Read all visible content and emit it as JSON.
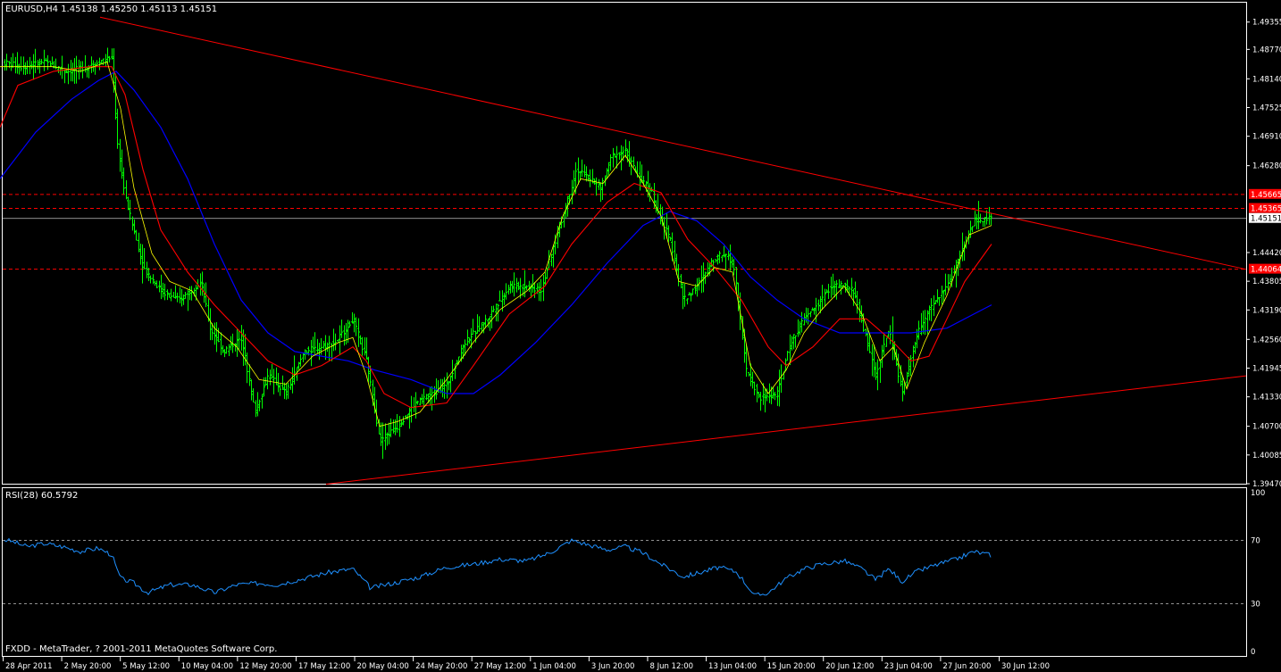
{
  "chart_header": "EURUSD,H4  1.45138 1.45250 1.45113 1.45151",
  "rsi_header": "RSI(28) 60.5792",
  "copyright": "FXDD - MetaTrader, ? 2001-2011 MetaQuotes Software Corp.",
  "colors": {
    "background": "#000000",
    "frame": "#ffffff",
    "bar": "#00ff00",
    "ma_fast": "#ffff00",
    "ma_mid": "#ff0000",
    "ma_slow": "#0000ff",
    "trendline": "#ff0000",
    "level": "#ff0000",
    "bid_line": "#c0c0c0",
    "rsi": "#1e90ff",
    "rsi_level": "#c0c0c0"
  },
  "chart_data": [
    {
      "type": "candlestick",
      "symbol": "EURUSD",
      "timeframe": "H4",
      "ohlc_current": {
        "open": 1.45138,
        "high": 1.4525,
        "low": 1.45113,
        "close": 1.45151
      },
      "ylim": [
        1.3947,
        1.4977
      ],
      "y_ticks": [
        "1.49355",
        "1.48770",
        "1.48140",
        "1.47525",
        "1.46910",
        "1.46280",
        "1.44420",
        "1.43805",
        "1.43190",
        "1.42560",
        "1.41945",
        "1.41330",
        "1.40700",
        "1.40085",
        "1.39470"
      ],
      "x_ticks": [
        "28 Apr 2011",
        "2 May 20:00",
        "5 May 12:00",
        "10 May 04:00",
        "12 May 20:00",
        "17 May 12:00",
        "20 May 04:00",
        "24 May 20:00",
        "27 May 12:00",
        "1 Jun 04:00",
        "3 Jun 20:00",
        "8 Jun 12:00",
        "13 Jun 04:00",
        "15 Jun 20:00",
        "20 Jun 12:00",
        "23 Jun 04:00",
        "27 Jun 20:00",
        "30 Jun 12:00"
      ],
      "bid_price": "1.45151",
      "price_levels": [
        "1.45665",
        "1.45365",
        "1.44064"
      ],
      "close_path": [
        [
          0,
          1.485
        ],
        [
          25,
          1.484
        ],
        [
          50,
          1.485
        ],
        [
          75,
          1.483
        ],
        [
          100,
          1.484
        ],
        [
          125,
          1.486
        ],
        [
          131,
          1.468
        ],
        [
          140,
          1.456
        ],
        [
          160,
          1.441
        ],
        [
          180,
          1.436
        ],
        [
          200,
          1.434
        ],
        [
          225,
          1.438
        ],
        [
          235,
          1.428
        ],
        [
          250,
          1.423
        ],
        [
          270,
          1.426
        ],
        [
          285,
          1.41
        ],
        [
          300,
          1.418
        ],
        [
          320,
          1.414
        ],
        [
          340,
          1.423
        ],
        [
          360,
          1.424
        ],
        [
          375,
          1.425
        ],
        [
          395,
          1.43
        ],
        [
          410,
          1.421
        ],
        [
          425,
          1.404
        ],
        [
          445,
          1.407
        ],
        [
          465,
          1.412
        ],
        [
          485,
          1.414
        ],
        [
          500,
          1.416
        ],
        [
          520,
          1.425
        ],
        [
          545,
          1.43
        ],
        [
          570,
          1.437
        ],
        [
          590,
          1.437
        ],
        [
          605,
          1.436
        ],
        [
          625,
          1.449
        ],
        [
          645,
          1.462
        ],
        [
          660,
          1.46
        ],
        [
          672,
          1.458
        ],
        [
          685,
          1.465
        ],
        [
          700,
          1.466
        ],
        [
          715,
          1.46
        ],
        [
          728,
          1.458
        ],
        [
          735,
          1.453
        ],
        [
          750,
          1.447
        ],
        [
          765,
          1.434
        ],
        [
          780,
          1.437
        ],
        [
          800,
          1.443
        ],
        [
          812,
          1.444
        ],
        [
          822,
          1.441
        ],
        [
          835,
          1.419
        ],
        [
          850,
          1.413
        ],
        [
          870,
          1.414
        ],
        [
          885,
          1.425
        ],
        [
          900,
          1.43
        ],
        [
          915,
          1.433
        ],
        [
          930,
          1.437
        ],
        [
          945,
          1.437
        ],
        [
          955,
          1.436
        ],
        [
          965,
          1.429
        ],
        [
          980,
          1.418
        ],
        [
          995,
          1.428
        ],
        [
          1010,
          1.414
        ],
        [
          1025,
          1.426
        ],
        [
          1040,
          1.432
        ],
        [
          1060,
          1.437
        ],
        [
          1075,
          1.444
        ],
        [
          1090,
          1.451
        ],
        [
          1110,
          1.4515
        ]
      ],
      "ma_fast_path": [
        [
          0,
          1.484
        ],
        [
          30,
          1.484
        ],
        [
          60,
          1.484
        ],
        [
          90,
          1.483
        ],
        [
          120,
          1.485
        ],
        [
          135,
          1.475
        ],
        [
          150,
          1.458
        ],
        [
          170,
          1.444
        ],
        [
          190,
          1.438
        ],
        [
          215,
          1.436
        ],
        [
          240,
          1.428
        ],
        [
          265,
          1.424
        ],
        [
          290,
          1.417
        ],
        [
          320,
          1.416
        ],
        [
          350,
          1.422
        ],
        [
          380,
          1.425
        ],
        [
          395,
          1.426
        ],
        [
          410,
          1.418
        ],
        [
          425,
          1.407
        ],
        [
          445,
          1.408
        ],
        [
          470,
          1.41
        ],
        [
          500,
          1.417
        ],
        [
          530,
          1.425
        ],
        [
          560,
          1.432
        ],
        [
          590,
          1.436
        ],
        [
          610,
          1.44
        ],
        [
          630,
          1.452
        ],
        [
          650,
          1.46
        ],
        [
          675,
          1.459
        ],
        [
          700,
          1.465
        ],
        [
          720,
          1.459
        ],
        [
          740,
          1.452
        ],
        [
          760,
          1.438
        ],
        [
          780,
          1.437
        ],
        [
          800,
          1.441
        ],
        [
          820,
          1.44
        ],
        [
          840,
          1.42
        ],
        [
          860,
          1.414
        ],
        [
          880,
          1.419
        ],
        [
          900,
          1.427
        ],
        [
          920,
          1.432
        ],
        [
          945,
          1.437
        ],
        [
          965,
          1.431
        ],
        [
          985,
          1.421
        ],
        [
          1000,
          1.424
        ],
        [
          1015,
          1.415
        ],
        [
          1035,
          1.425
        ],
        [
          1060,
          1.435
        ],
        [
          1085,
          1.448
        ],
        [
          1110,
          1.45
        ]
      ],
      "ma_mid_path": [
        [
          0,
          1.471
        ],
        [
          20,
          1.48
        ],
        [
          60,
          1.483
        ],
        [
          100,
          1.484
        ],
        [
          125,
          1.484
        ],
        [
          140,
          1.478
        ],
        [
          160,
          1.462
        ],
        [
          180,
          1.449
        ],
        [
          210,
          1.44
        ],
        [
          240,
          1.433
        ],
        [
          270,
          1.427
        ],
        [
          300,
          1.421
        ],
        [
          330,
          1.418
        ],
        [
          360,
          1.42
        ],
        [
          395,
          1.424
        ],
        [
          410,
          1.421
        ],
        [
          430,
          1.414
        ],
        [
          460,
          1.411
        ],
        [
          500,
          1.412
        ],
        [
          530,
          1.42
        ],
        [
          570,
          1.431
        ],
        [
          610,
          1.437
        ],
        [
          640,
          1.446
        ],
        [
          680,
          1.455
        ],
        [
          710,
          1.459
        ],
        [
          740,
          1.457
        ],
        [
          770,
          1.447
        ],
        [
          800,
          1.441
        ],
        [
          830,
          1.434
        ],
        [
          860,
          1.424
        ],
        [
          880,
          1.42
        ],
        [
          910,
          1.424
        ],
        [
          940,
          1.43
        ],
        [
          970,
          1.43
        ],
        [
          1000,
          1.425
        ],
        [
          1020,
          1.421
        ],
        [
          1040,
          1.422
        ],
        [
          1060,
          1.43
        ],
        [
          1080,
          1.438
        ],
        [
          1110,
          1.446
        ]
      ],
      "ma_slow_path": [
        [
          0,
          1.46
        ],
        [
          40,
          1.47
        ],
        [
          80,
          1.477
        ],
        [
          110,
          1.481
        ],
        [
          130,
          1.483
        ],
        [
          150,
          1.479
        ],
        [
          180,
          1.471
        ],
        [
          210,
          1.46
        ],
        [
          240,
          1.446
        ],
        [
          270,
          1.434
        ],
        [
          300,
          1.427
        ],
        [
          330,
          1.423
        ],
        [
          360,
          1.422
        ],
        [
          390,
          1.421
        ],
        [
          420,
          1.419
        ],
        [
          460,
          1.417
        ],
        [
          500,
          1.414
        ],
        [
          530,
          1.414
        ],
        [
          560,
          1.418
        ],
        [
          600,
          1.425
        ],
        [
          640,
          1.433
        ],
        [
          680,
          1.442
        ],
        [
          720,
          1.45
        ],
        [
          750,
          1.453
        ],
        [
          780,
          1.451
        ],
        [
          810,
          1.446
        ],
        [
          840,
          1.439
        ],
        [
          870,
          1.434
        ],
        [
          900,
          1.43
        ],
        [
          940,
          1.427
        ],
        [
          980,
          1.427
        ],
        [
          1020,
          1.427
        ],
        [
          1060,
          1.428
        ],
        [
          1090,
          1.431
        ],
        [
          1110,
          1.433
        ]
      ],
      "trendlines": [
        {
          "from": [
            112,
            1.4946
          ],
          "to": [
            1395,
            1.4406
          ]
        },
        {
          "from": [
            365,
            1.3946
          ],
          "to": [
            1395,
            1.4178
          ]
        }
      ]
    },
    {
      "type": "line",
      "indicator": "RSI(28)",
      "current_value": 60.5792,
      "ylim": [
        0,
        100
      ],
      "y_ticks": [
        "100",
        "70",
        "30",
        "0"
      ],
      "levels": [
        70,
        30
      ],
      "rsi_path": [
        [
          0,
          71
        ],
        [
          15,
          69
        ],
        [
          30,
          66
        ],
        [
          50,
          68
        ],
        [
          70,
          66
        ],
        [
          90,
          63
        ],
        [
          110,
          65
        ],
        [
          125,
          61
        ],
        [
          135,
          46
        ],
        [
          150,
          43
        ],
        [
          165,
          37
        ],
        [
          190,
          42
        ],
        [
          215,
          42
        ],
        [
          240,
          37
        ],
        [
          265,
          42
        ],
        [
          290,
          43
        ],
        [
          310,
          42
        ],
        [
          340,
          46
        ],
        [
          370,
          50
        ],
        [
          395,
          52
        ],
        [
          415,
          40
        ],
        [
          440,
          43
        ],
        [
          470,
          47
        ],
        [
          500,
          53
        ],
        [
          530,
          55
        ],
        [
          560,
          58
        ],
        [
          590,
          57
        ],
        [
          615,
          62
        ],
        [
          640,
          70
        ],
        [
          660,
          67
        ],
        [
          680,
          64
        ],
        [
          700,
          66
        ],
        [
          720,
          62
        ],
        [
          740,
          55
        ],
        [
          765,
          47
        ],
        [
          785,
          50
        ],
        [
          805,
          53
        ],
        [
          825,
          50
        ],
        [
          845,
          35
        ],
        [
          860,
          37
        ],
        [
          880,
          46
        ],
        [
          900,
          52
        ],
        [
          920,
          55
        ],
        [
          945,
          57
        ],
        [
          965,
          52
        ],
        [
          980,
          45
        ],
        [
          995,
          52
        ],
        [
          1010,
          44
        ],
        [
          1025,
          50
        ],
        [
          1045,
          54
        ],
        [
          1070,
          58
        ],
        [
          1090,
          63
        ],
        [
          1110,
          60.58
        ]
      ]
    }
  ]
}
